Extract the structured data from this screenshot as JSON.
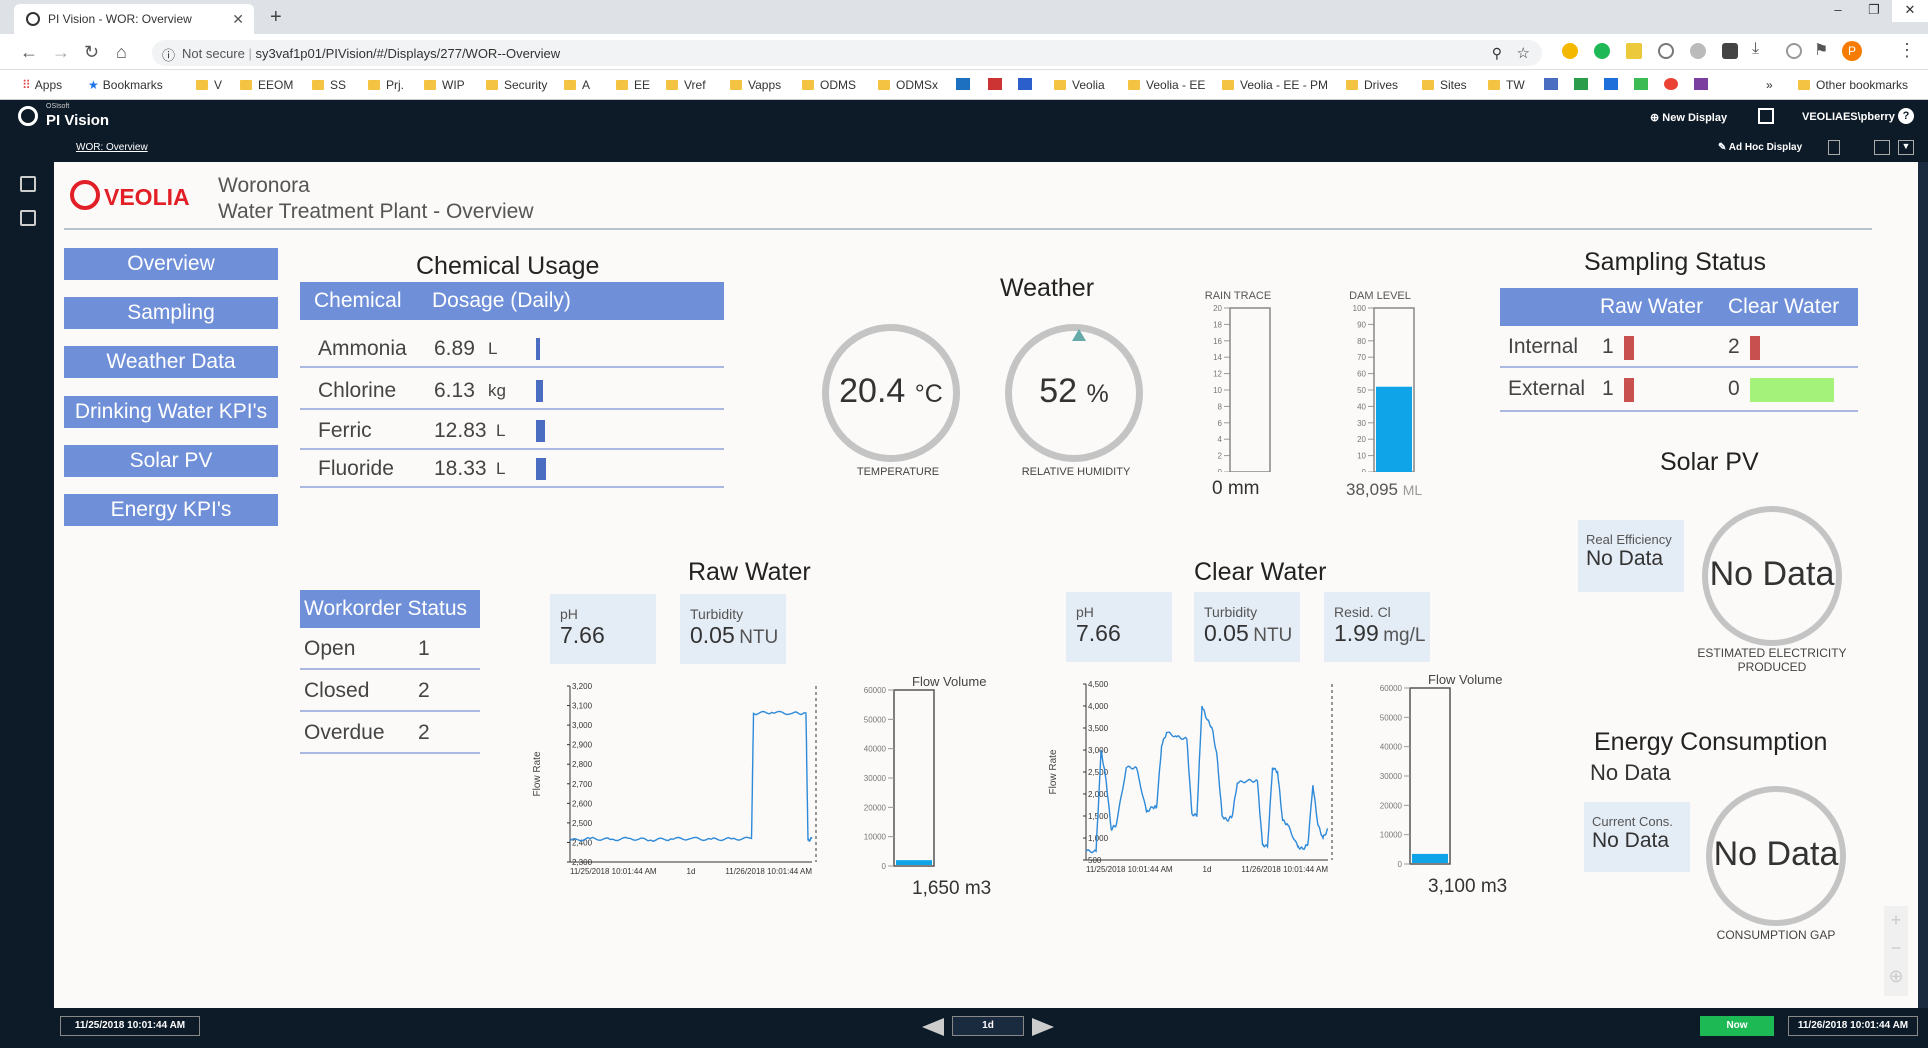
{
  "browser": {
    "tab_title": "PI Vision - WOR: Overview",
    "url_prefix": "Not secure",
    "url": "sy3vaf1p01/PIVision/#/Displays/277/WOR--Overview",
    "bookmarks": [
      "Apps",
      "Bookmarks",
      "V",
      "EEOM",
      "SS",
      "Prj.",
      "WIP",
      "Security",
      "A",
      "EE",
      "Vref",
      "Vapps",
      "ODMS",
      "ODMSx",
      "Veolia",
      "Veolia - EE",
      "Veolia - EE - PM",
      "Drives",
      "Sites",
      "TW"
    ],
    "other_bookmarks": "Other bookmarks",
    "more": "»"
  },
  "pi": {
    "brand_small": "OSIsoft",
    "brand": "PI Vision",
    "new_display": "New Display",
    "user": "VEOLIAES\\pberry",
    "breadcrumb": "WOR: Overview",
    "adhoc": "Ad Hoc Display"
  },
  "header": {
    "logo": "VEOLIA",
    "site": "Woronora",
    "subtitle": "Water Treatment Plant - Overview"
  },
  "nav": [
    "Overview",
    "Sampling",
    "Weather Data",
    "Drinking Water KPI's",
    "Solar PV",
    "Energy KPI's"
  ],
  "chemical": {
    "title": "Chemical Usage",
    "col1": "Chemical",
    "col2": "Dosage (Daily)",
    "rows": [
      {
        "name": "Ammonia",
        "value": "6.89",
        "unit": "L"
      },
      {
        "name": "Chlorine",
        "value": "6.13",
        "unit": "kg"
      },
      {
        "name": "Ferric",
        "value": "12.83",
        "unit": "L"
      },
      {
        "name": "Fluoride",
        "value": "18.33",
        "unit": "L"
      }
    ]
  },
  "weather": {
    "title": "Weather",
    "temp_value": "20.4",
    "temp_unit": "°C",
    "temp_label": "TEMPERATURE",
    "hum_value": "52",
    "hum_unit": "%",
    "hum_label": "RELATIVE HUMIDITY",
    "rain_label": "RAIN TRACE",
    "rain_value": "0",
    "rain_unit": "mm",
    "rain_ticks": [
      "20",
      "18",
      "16",
      "14",
      "12",
      "10",
      "8",
      "6",
      "4",
      "2",
      "0"
    ],
    "rain_max": 20,
    "rain_level": 0,
    "dam_label": "DAM LEVEL",
    "dam_value": "38,095",
    "dam_unit": "ML",
    "dam_ticks": [
      "100",
      "90",
      "80",
      "70",
      "60",
      "50",
      "40",
      "30",
      "20",
      "10",
      "0"
    ],
    "dam_max": 100,
    "dam_level": 52,
    "fill_color": "#0fa3e8"
  },
  "sampling": {
    "title": "Sampling Status",
    "col1": "Raw Water",
    "col2": "Clear Water",
    "rows": [
      {
        "name": "Internal",
        "raw": "1",
        "clear": "2"
      },
      {
        "name": "External",
        "raw": "1",
        "clear": "0"
      }
    ]
  },
  "solar": {
    "title": "Solar PV",
    "eff_label": "Real Efficiency",
    "eff_value": "No Data",
    "gauge_value": "No Data",
    "gauge_label1": "ESTIMATED ELECTRICITY",
    "gauge_label2": "PRODUCED"
  },
  "energy": {
    "title": "Energy Consumption",
    "value": "No Data",
    "cons_label": "Current Cons.",
    "cons_value": "No Data",
    "gauge_value": "No Data",
    "gauge_label": "CONSUMPTION GAP"
  },
  "workorder": {
    "title": "Workorder Status",
    "rows": [
      {
        "name": "Open",
        "value": "1"
      },
      {
        "name": "Closed",
        "value": "2"
      },
      {
        "name": "Overdue",
        "value": "2"
      }
    ]
  },
  "raw_water": {
    "title": "Raw Water",
    "ph_label": "pH",
    "ph_value": "7.66",
    "turb_label": "Turbidity",
    "turb_value": "0.05",
    "turb_unit": "NTU",
    "flow_volume_label": "Flow Volume",
    "flow_volume_value": "1,650",
    "flow_volume_unit": "m3",
    "flow_volume_max": 60000,
    "flow_volume_level": 1650
  },
  "clear_water": {
    "title": "Clear Water",
    "ph_label": "pH",
    "ph_value": "7.66",
    "turb_label": "Turbidity",
    "turb_value": "0.05",
    "turb_unit": "NTU",
    "cl_label": "Resid. Cl",
    "cl_value": "1.99",
    "cl_unit": "mg/L",
    "flow_volume_label": "Flow Volume",
    "flow_volume_value": "3,100",
    "flow_volume_unit": "m3",
    "flow_volume_max": 60000,
    "flow_volume_level": 3100
  },
  "chart_data": [
    {
      "type": "line",
      "title": "Raw Water",
      "ylabel": "Flow Rate",
      "x_tick_labels": [
        "11/25/2018 10:01:44 AM",
        "1d",
        "11/26/2018 10:01:44 AM"
      ],
      "ylim": [
        2300,
        3200
      ],
      "y_ticks": [
        2300,
        2400,
        2500,
        2600,
        2700,
        2800,
        2900,
        3000,
        3100,
        3200
      ],
      "y_tick_labels": [
        "2,300",
        "2,400",
        "2,500",
        "2,600",
        "2,700",
        "2,800",
        "2,900",
        "3,000",
        "3,100",
        "3,200"
      ],
      "x_range": [
        0,
        24
      ],
      "series": [
        {
          "x": [
            0,
            2,
            4,
            6,
            8,
            10,
            12,
            14,
            16,
            18,
            18.2,
            20,
            22,
            23.4,
            23.6,
            24
          ],
          "y": [
            2410,
            2420,
            2415,
            2420,
            2412,
            2418,
            2420,
            2416,
            2418,
            2420,
            3060,
            3065,
            3060,
            3062,
            2410,
            2420
          ]
        }
      ]
    },
    {
      "type": "bar",
      "title": "Flow Volume",
      "ylim": [
        0,
        60000
      ],
      "y_ticks": [
        0,
        10000,
        20000,
        30000,
        40000,
        50000,
        60000
      ],
      "values": [
        1650
      ]
    },
    {
      "type": "line",
      "title": "Clear Water",
      "ylabel": "Flow Rate",
      "x_tick_labels": [
        "11/25/2018 10:01:44 AM",
        "1d",
        "11/26/2018 10:01:44 AM"
      ],
      "ylim": [
        500,
        4500
      ],
      "y_ticks": [
        500,
        1000,
        1500,
        2000,
        2500,
        3000,
        3500,
        4000,
        4500
      ],
      "y_tick_labels": [
        "500",
        "1,000",
        "1,500",
        "2,000",
        "2,500",
        "3,000",
        "3,500",
        "4,000",
        "4,500"
      ],
      "x_range": [
        0,
        24
      ],
      "series": [
        {
          "x": [
            0,
            1.0,
            1.5,
            2,
            2.5,
            3,
            4,
            5,
            6,
            6.6,
            7,
            7.5,
            8,
            9,
            10,
            10.5,
            11,
            11.5,
            12,
            12.5,
            13,
            13.5,
            14,
            14.5,
            15,
            16,
            17,
            17.5,
            18,
            18.5,
            19,
            19.5,
            20,
            21,
            21.5,
            22,
            22.5,
            23,
            23.5,
            24
          ],
          "y": [
            700,
            700,
            3000,
            2300,
            1200,
            1300,
            2600,
            2600,
            1600,
            1700,
            1700,
            3100,
            3400,
            3300,
            3250,
            1550,
            1500,
            4000,
            3700,
            3500,
            2850,
            1500,
            1400,
            1500,
            2250,
            2300,
            2300,
            850,
            800,
            2600,
            2500,
            1400,
            1300,
            800,
            750,
            850,
            2200,
            1300,
            1000,
            1200
          ]
        }
      ]
    },
    {
      "type": "bar",
      "title": "Flow Volume",
      "ylim": [
        0,
        60000
      ],
      "y_ticks": [
        0,
        10000,
        20000,
        30000,
        40000,
        50000,
        60000
      ],
      "values": [
        3100
      ]
    }
  ],
  "bottom": {
    "start": "11/25/2018 10:01:44 AM",
    "duration": "1d",
    "now": "Now",
    "end": "11/26/2018 10:01:44 AM"
  },
  "colors": {
    "accent": "#6f8fd8",
    "status_red": "#c8504e",
    "status_green": "#a5f27a",
    "line": "#2e8ad8"
  }
}
